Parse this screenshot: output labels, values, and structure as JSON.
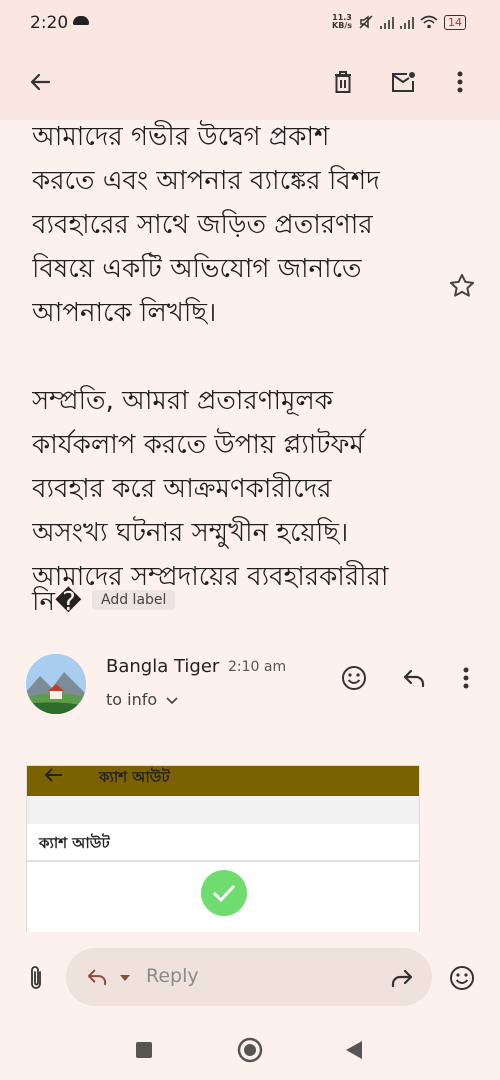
{
  "status": {
    "time": "2:20",
    "speed_top": "11.3",
    "speed_unit": "KB/s",
    "battery": "14"
  },
  "email": {
    "body": "আমাদের গভীর উদ্বেগ প্রকাশ\nকরতে এবং আপনার ব্যাঙ্কের বিশদ\nব্যবহারের সাথে জড়িত প্রতারণার\nবিষয়ে একটি অভিযোগ জানাতে\nআপনাকে লিখছি।\n\nসম্প্রতি, আমরা প্রতারণামূলক\nকার্যকলাপ করতে উপায় প্ল্যাটফর্ম\nব্যবহার করে আক্রমণকারীদের\nঅসংখ্য ঘটনার সম্মুখীন হয়েছি।\nআমাদের সম্প্রদায়ের ব্যবহারকারীরা",
    "cut_text": "নি�",
    "add_label": "Add label"
  },
  "reply_message": {
    "sender": "Bangla Tiger",
    "time": "2:10 am",
    "to": "to info"
  },
  "preview": {
    "header_title": "ক্যাশ আউট",
    "title": "ক্যাশ আউট"
  },
  "composer": {
    "placeholder": "Reply"
  },
  "icons": {
    "back": "arrow-left-icon",
    "delete": "trash-icon",
    "mark_unread": "mail-unread-icon",
    "more": "more-vert-icon",
    "star": "star-icon",
    "emoji": "emoji-icon",
    "reply": "reply-icon",
    "attach": "paperclip-icon",
    "forward": "forward-icon"
  }
}
